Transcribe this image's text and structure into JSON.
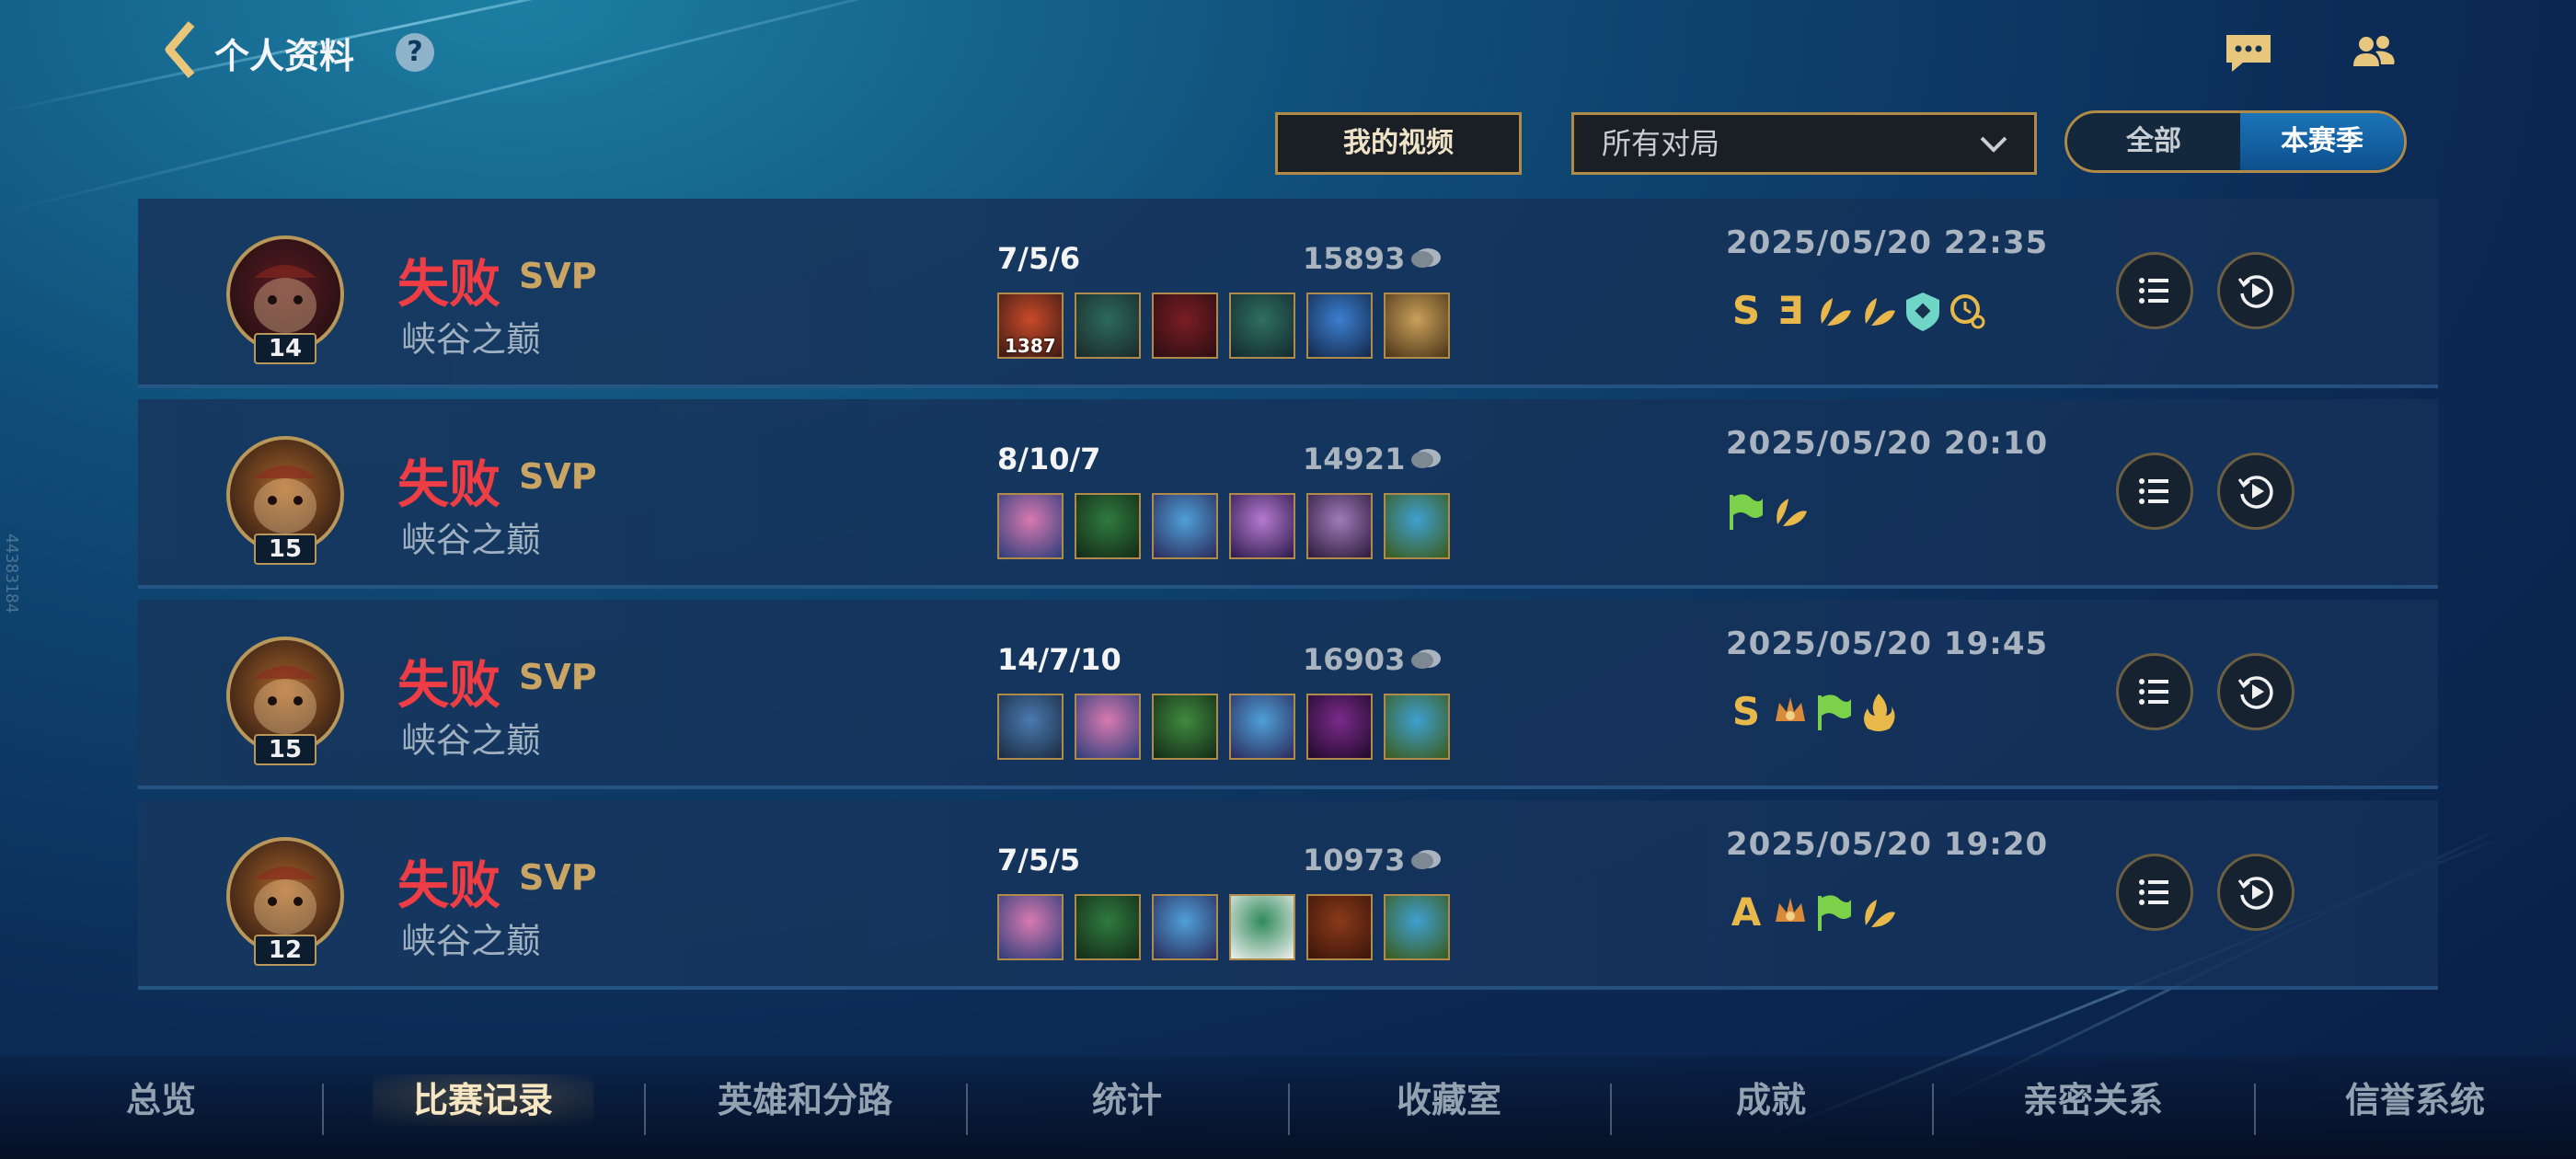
{
  "header": {
    "title": "个人资料",
    "help_icon": "question-icon",
    "chat_icon": "chat-bubble-icon",
    "friends_icon": "friends-icon"
  },
  "filters": {
    "video_label": "我的视频",
    "match_filter": "所有对局",
    "toggle_all": "全部",
    "toggle_season": "本赛季",
    "toggle_selected": "本赛季"
  },
  "side_id": "44383184",
  "matches": [
    {
      "level": "14",
      "result": "失败",
      "svp": "SVP",
      "mode": "峡谷之巅",
      "kda": "7/5/6",
      "gold": "15893",
      "item_count_label": "1387",
      "time": "2025/05/20 22:35",
      "badges": [
        "S",
        "Ǝ",
        "leaf",
        "leaf",
        "shield",
        "clock"
      ]
    },
    {
      "level": "15",
      "result": "失败",
      "svp": "SVP",
      "mode": "峡谷之巅",
      "kda": "8/10/7",
      "gold": "14921",
      "time": "2025/05/20 20:10",
      "badges": [
        "flag",
        "leaf"
      ]
    },
    {
      "level": "15",
      "result": "失败",
      "svp": "SVP",
      "mode": "峡谷之巅",
      "kda": "14/7/10",
      "gold": "16903",
      "time": "2025/05/20 19:45",
      "badges": [
        "S",
        "crown",
        "flag",
        "fire"
      ]
    },
    {
      "level": "12",
      "result": "失败",
      "svp": "SVP",
      "mode": "峡谷之巅",
      "kda": "7/5/5",
      "gold": "10973",
      "time": "2025/05/20 19:20",
      "badges": [
        "A",
        "crown",
        "flag",
        "leaf"
      ]
    }
  ],
  "nav": {
    "tabs": [
      "总览",
      "比赛记录",
      "英雄和分路",
      "统计",
      "收藏室",
      "成就",
      "亲密关系",
      "信誉系统"
    ],
    "active": "比赛记录"
  },
  "colors": {
    "loss": "#ee3d44",
    "svp": "#c9a463",
    "border_gold": "#b08a48",
    "badge_gold": "#e8b84a",
    "badge_green": "#7cd14a",
    "badge_teal": "#6fd6c7"
  }
}
